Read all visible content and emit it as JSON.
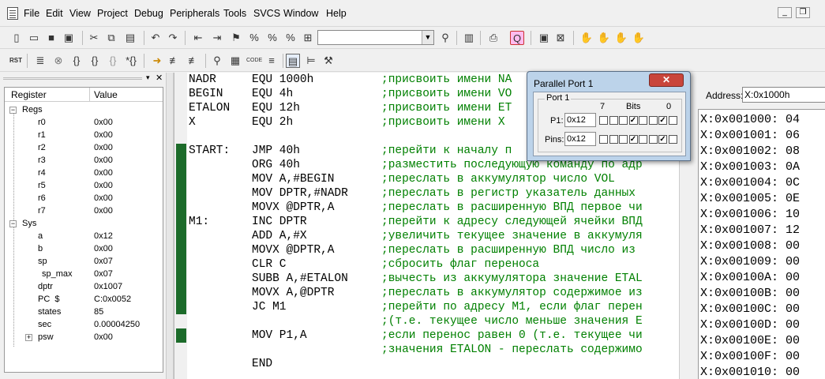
{
  "menubar": {
    "items": [
      "File",
      "Edit",
      "View",
      "Project",
      "Debug",
      "Peripherals",
      "Tools",
      "SVCS",
      "Window",
      "Help"
    ],
    "window_minimize": "_",
    "window_restore": "❐"
  },
  "toolbar1": {
    "search_combo_value": "",
    "icons": [
      "new-file-icon",
      "open-file-icon",
      "save-icon",
      "save-all-icon",
      "cut-icon",
      "copy-icon",
      "paste-icon",
      "undo-icon",
      "redo-icon",
      "indent-icon",
      "outdent-icon",
      "bookmark-icon",
      "prev-bookmark-icon",
      "next-bookmark-icon",
      "clear-bookmarks-icon",
      "find-in-files-icon",
      "find-icon",
      "incremental-find-icon",
      "print-icon",
      "debug-session-icon",
      "breakpoint-icon",
      "window-icon",
      "kill-icon",
      "hand-icon"
    ]
  },
  "toolbar2": {
    "icons": [
      "reset-icon",
      "run-icon",
      "stop-icon",
      "step-into-icon",
      "step-over-icon",
      "step-out-icon",
      "run-to-cursor-icon",
      "show-next-statement-icon",
      "trace-icon",
      "disassembly-icon",
      "command-window-icon",
      "symbols-icon",
      "code-coverage-icon",
      "serial-window-icon",
      "memory-window-icon",
      "performance-analyzer-icon",
      "tools-icon"
    ]
  },
  "registers": {
    "header_register": "Register",
    "header_value": "Value",
    "groups": [
      {
        "name": "Regs",
        "rows": [
          {
            "name": "r0",
            "value": "0x00"
          },
          {
            "name": "r1",
            "value": "0x00"
          },
          {
            "name": "r2",
            "value": "0x00"
          },
          {
            "name": "r3",
            "value": "0x00"
          },
          {
            "name": "r4",
            "value": "0x00"
          },
          {
            "name": "r5",
            "value": "0x00"
          },
          {
            "name": "r6",
            "value": "0x00"
          },
          {
            "name": "r7",
            "value": "0x00"
          }
        ]
      },
      {
        "name": "Sys",
        "rows": [
          {
            "name": "a",
            "value": "0x12"
          },
          {
            "name": "b",
            "value": "0x00"
          },
          {
            "name": "sp",
            "value": "0x07"
          },
          {
            "name": "sp_max",
            "value": "0x07"
          },
          {
            "name": "dptr",
            "value": "0x1007"
          },
          {
            "name": "PC  $",
            "value": "C:0x0052"
          },
          {
            "name": "states",
            "value": "85"
          },
          {
            "name": "sec",
            "value": "0.00004250"
          },
          {
            "name": "psw",
            "value": "0x00"
          }
        ]
      }
    ]
  },
  "code": {
    "lines": [
      {
        "label": "NADR",
        "instr": "EQU 1000h",
        "comment": ";присвоить имени NA"
      },
      {
        "label": "BEGIN",
        "instr": "EQU 4h",
        "comment": ";присвоить имени VO"
      },
      {
        "label": "ETALON",
        "instr": "EQU 12h",
        "comment": ";присвоить имени ET"
      },
      {
        "label": "X",
        "instr": "EQU 2h",
        "comment": ";присвоить имени X"
      },
      {
        "label": "",
        "instr": "",
        "comment": ""
      },
      {
        "label": "START:",
        "instr": "JMP 40h",
        "comment": ";перейти к началу п"
      },
      {
        "label": "",
        "instr": "ORG 40h",
        "comment": ";разместить последующую команду по адр"
      },
      {
        "label": "",
        "instr": "MOV A,#BEGIN",
        "comment": ";переслать в аккумулятор число VOL"
      },
      {
        "label": "",
        "instr": "MOV DPTR,#NADR",
        "comment": ";переслать в регистр указатель данных"
      },
      {
        "label": "",
        "instr": "MOVX @DPTR,A",
        "comment": ";переслать в расширенную ВПД первое чи"
      },
      {
        "label": "M1:",
        "instr": "INC DPTR",
        "comment": ";перейти к адресу следующей ячейки ВПД"
      },
      {
        "label": "",
        "instr": "ADD A,#X",
        "comment": ";увеличить текущее значение в аккумуля"
      },
      {
        "label": "",
        "instr": "MOVX @DPTR,A",
        "comment": ";переслать в расширенную ВПД число из"
      },
      {
        "label": "",
        "instr": "CLR C",
        "comment": ";сбросить флаг переноса"
      },
      {
        "label": "",
        "instr": "SUBB A,#ETALON",
        "comment": ";вычесть из аккумулятора значение ETAL"
      },
      {
        "label": "",
        "instr": "MOVX A,@DPTR",
        "comment": ";переслать в аккумулятор содержимое из"
      },
      {
        "label": "",
        "instr": "JC M1",
        "comment": ";перейти по адресу M1, если флаг перен"
      },
      {
        "label": "",
        "instr": "",
        "comment": ";(т.е. текущее число меньше значения E"
      },
      {
        "label": "",
        "instr": "MOV P1,A",
        "comment": ";если перенос равен 0 (т.е. текущее чи"
      },
      {
        "label": "",
        "instr": "",
        "comment": ";значения ETALON - переслать содержимо"
      },
      {
        "label": "",
        "instr": "END",
        "comment": ""
      }
    ]
  },
  "parallel_port": {
    "title": "Parallel Port 1",
    "close": "✕",
    "group_title": "Port 1",
    "bits_label": "Bits",
    "bit_high": "7",
    "bit_low": "0",
    "p1_label": "P1:",
    "p1_value": "0x12",
    "pins_label": "Pins:",
    "pins_value": "0x12",
    "p1_bits": [
      0,
      0,
      0,
      1,
      0,
      0,
      1,
      0
    ],
    "pins_bits": [
      0,
      0,
      0,
      1,
      0,
      0,
      1,
      0
    ]
  },
  "memory": {
    "address_label": "Address:",
    "address_value": "X:0x1000h",
    "rows": [
      "X:0x001000: 04",
      "X:0x001001: 06",
      "X:0x001002: 08",
      "X:0x001003: 0A",
      "X:0x001004: 0C",
      "X:0x001005: 0E",
      "X:0x001006: 10",
      "X:0x001007: 12",
      "X:0x001008: 00",
      "X:0x001009: 00",
      "X:0x00100A: 00",
      "X:0x00100B: 00",
      "X:0x00100C: 00",
      "X:0x00100D: 00",
      "X:0x00100E: 00",
      "X:0x00100F: 00",
      "X:0x001010: 00"
    ]
  }
}
